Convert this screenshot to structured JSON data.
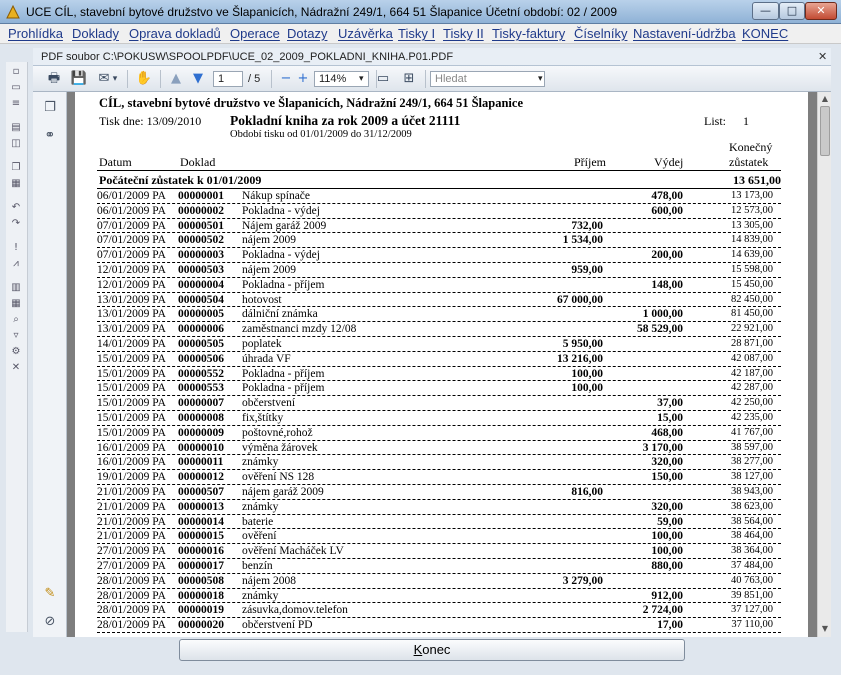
{
  "window": {
    "title": "UCE   CÍL, stavební bytové družstvo ve Šlapanicích, Nádražní 249/1, 664 51  Šlapanice   Účetní období: 02 / 2009",
    "min_glyph": "—",
    "max_glyph": "□",
    "close_glyph": "✕"
  },
  "menu": [
    "Prohlídka",
    "Doklady",
    "Oprava dokladů",
    "Operace",
    "Dotazy",
    "Uzávěrka",
    "Tisky I",
    "Tisky II",
    "Tisky-faktury",
    "Číselníky",
    "Nastavení-údržba",
    "KONEC"
  ],
  "pdf": {
    "file_label": "PDF soubor C:\\POKUSW\\SPOOLPDF\\UCE_02_2009_POKLADNI_KNIHA.P01.PDF",
    "close_glyph": "✕"
  },
  "toolbar": {
    "page_current": "1",
    "page_total": "/ 5",
    "zoom": "114%",
    "zoom_arrow": "▾",
    "search_placeholder": "Hledat",
    "search_arrow": "▾",
    "icons": {
      "print": "🖶",
      "save": "💾",
      "share": "✉",
      "share_arrow": "▾",
      "hand": "✋",
      "prev": "▲",
      "next": "▼",
      "zoom_out": "−",
      "zoom_in": "+",
      "fit_page": "▭",
      "fit_width": "⊞"
    }
  },
  "sidepanel": {
    "pages_icon": "❐",
    "attach_icon": "⚭",
    "comment_icon": "✎",
    "clip_icon": "⊘"
  },
  "report": {
    "org": "CÍL, stavební bytové družstvo ve Šlapanicích, Nádražní 249/1, 664 51  Šlapanice",
    "print_date": "Tisk dne:  13/09/2010",
    "title": "Pokladní kniha za rok 2009 a účet 21111",
    "sheet_label": "List:",
    "sheet_no": "1",
    "period": "Období tisku od 01/01/2009 do 31/12/2009",
    "columns": {
      "date": "Datum",
      "doc": "Doklad",
      "income": "Příjem",
      "expense": "Výdej",
      "balance_1": "Konečný",
      "balance_2": "zůstatek"
    },
    "opening_label": "Počáteční zůstatek k 01/01/2009",
    "opening_value": "13 651,00",
    "rows": [
      {
        "date": "06/01/2009 PA",
        "doc": "00000001",
        "text": "Nákup spínače",
        "income": "",
        "expense": "478,00",
        "balance": "13 173,00"
      },
      {
        "date": "06/01/2009 PA",
        "doc": "00000002",
        "text": "Pokladna - výdej",
        "income": "",
        "expense": "600,00",
        "balance": "12 573,00"
      },
      {
        "date": "07/01/2009 PA",
        "doc": "00000501",
        "text": "Nájem garáž 2009",
        "income": "732,00",
        "expense": "",
        "balance": "13 305,00"
      },
      {
        "date": "07/01/2009 PA",
        "doc": "00000502",
        "text": "nájem 2009",
        "income": "1 534,00",
        "expense": "",
        "balance": "14 839,00"
      },
      {
        "date": "07/01/2009 PA",
        "doc": "00000003",
        "text": "Pokladna - výdej",
        "income": "",
        "expense": "200,00",
        "balance": "14 639,00"
      },
      {
        "date": "12/01/2009 PA",
        "doc": "00000503",
        "text": "nájem 2009",
        "income": "959,00",
        "expense": "",
        "balance": "15 598,00"
      },
      {
        "date": "12/01/2009 PA",
        "doc": "00000004",
        "text": "Pokladna - příjem",
        "income": "",
        "expense": "148,00",
        "balance": "15 450,00"
      },
      {
        "date": "13/01/2009 PA",
        "doc": "00000504",
        "text": "hotovost",
        "income": "67 000,00",
        "expense": "",
        "balance": "82 450,00"
      },
      {
        "date": "13/01/2009 PA",
        "doc": "00000005",
        "text": "dálniční známka",
        "income": "",
        "expense": "1 000,00",
        "balance": "81 450,00"
      },
      {
        "date": "13/01/2009 PA",
        "doc": "00000006",
        "text": "zaměstnanci mzdy 12/08",
        "income": "",
        "expense": "58 529,00",
        "balance": "22 921,00"
      },
      {
        "date": "14/01/2009 PA",
        "doc": "00000505",
        "text": "poplatek",
        "income": "5 950,00",
        "expense": "",
        "balance": "28 871,00"
      },
      {
        "date": "15/01/2009 PA",
        "doc": "00000506",
        "text": "úhrada VF",
        "income": "13 216,00",
        "expense": "",
        "balance": "42 087,00"
      },
      {
        "date": "15/01/2009 PA",
        "doc": "00000552",
        "text": "Pokladna - příjem",
        "income": "100,00",
        "expense": "",
        "balance": "42 187,00"
      },
      {
        "date": "15/01/2009 PA",
        "doc": "00000553",
        "text": "Pokladna - příjem",
        "income": "100,00",
        "expense": "",
        "balance": "42 287,00"
      },
      {
        "date": "15/01/2009 PA",
        "doc": "00000007",
        "text": "občerstvení",
        "income": "",
        "expense": "37,00",
        "balance": "42 250,00"
      },
      {
        "date": "15/01/2009 PA",
        "doc": "00000008",
        "text": "fix,štítky",
        "income": "",
        "expense": "15,00",
        "balance": "42 235,00"
      },
      {
        "date": "15/01/2009 PA",
        "doc": "00000009",
        "text": "poštovné,rohož",
        "income": "",
        "expense": "468,00",
        "balance": "41 767,00"
      },
      {
        "date": "16/01/2009 PA",
        "doc": "00000010",
        "text": "výměna žárovek",
        "income": "",
        "expense": "3 170,00",
        "balance": "38 597,00"
      },
      {
        "date": "16/01/2009 PA",
        "doc": "00000011",
        "text": "známky",
        "income": "",
        "expense": "320,00",
        "balance": "38 277,00"
      },
      {
        "date": "19/01/2009 PA",
        "doc": "00000012",
        "text": "ověření NS 128",
        "income": "",
        "expense": "150,00",
        "balance": "38 127,00"
      },
      {
        "date": "21/01/2009 PA",
        "doc": "00000507",
        "text": "nájem garáž 2009",
        "income": "816,00",
        "expense": "",
        "balance": "38 943,00"
      },
      {
        "date": "21/01/2009 PA",
        "doc": "00000013",
        "text": "známky",
        "income": "",
        "expense": "320,00",
        "balance": "38 623,00"
      },
      {
        "date": "21/01/2009 PA",
        "doc": "00000014",
        "text": "baterie",
        "income": "",
        "expense": "59,00",
        "balance": "38 564,00"
      },
      {
        "date": "21/01/2009 PA",
        "doc": "00000015",
        "text": "ověření",
        "income": "",
        "expense": "100,00",
        "balance": "38 464,00"
      },
      {
        "date": "27/01/2009 PA",
        "doc": "00000016",
        "text": "ověření Macháček LV",
        "income": "",
        "expense": "100,00",
        "balance": "38 364,00"
      },
      {
        "date": "27/01/2009 PA",
        "doc": "00000017",
        "text": "benzín",
        "income": "",
        "expense": "880,00",
        "balance": "37 484,00"
      },
      {
        "date": "28/01/2009 PA",
        "doc": "00000508",
        "text": "nájem 2008",
        "income": "3 279,00",
        "expense": "",
        "balance": "40 763,00"
      },
      {
        "date": "28/01/2009 PA",
        "doc": "00000018",
        "text": "známky",
        "income": "",
        "expense": "912,00",
        "balance": "39 851,00"
      },
      {
        "date": "28/01/2009 PA",
        "doc": "00000019",
        "text": "zásuvka,domov.telefon",
        "income": "",
        "expense": "2 724,00",
        "balance": "37 127,00"
      },
      {
        "date": "28/01/2009 PA",
        "doc": "00000020",
        "text": "občerstvení PD",
        "income": "",
        "expense": "17,00",
        "balance": "37 110,00"
      }
    ]
  },
  "scroll": {
    "up": "▲",
    "down": "▼"
  },
  "footer": {
    "konec_first": "K",
    "konec_rest": "onec"
  }
}
